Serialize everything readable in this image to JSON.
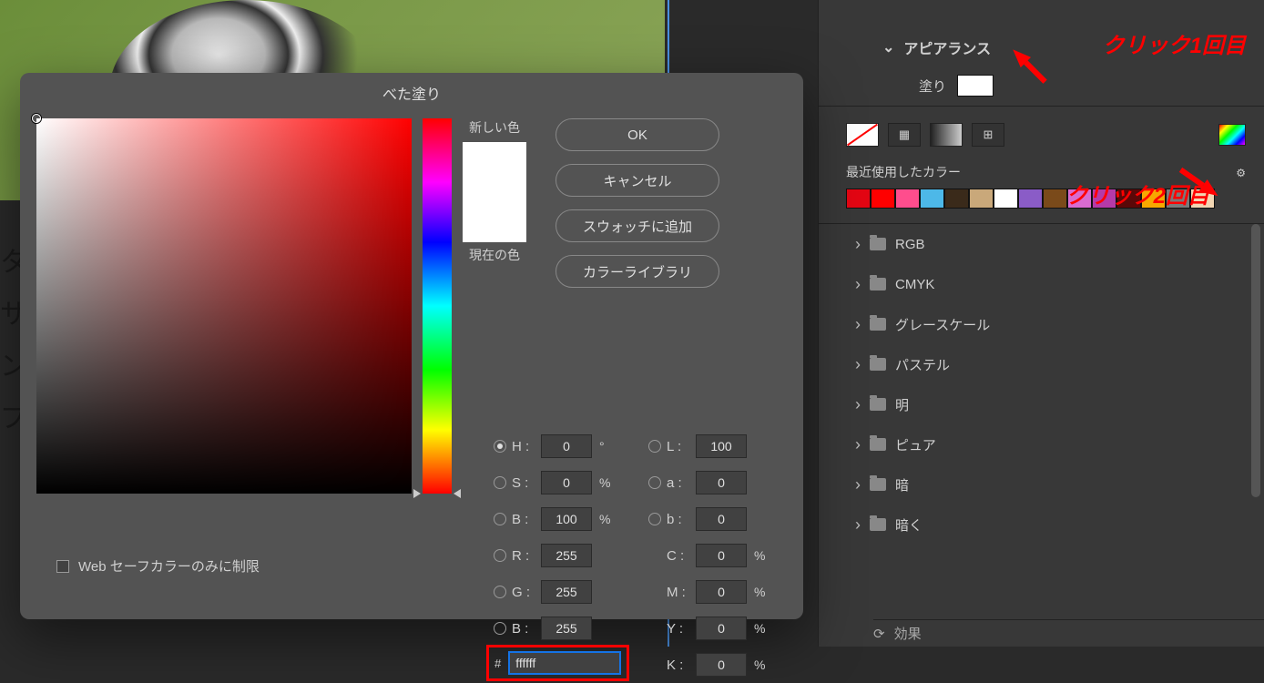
{
  "dialog": {
    "title": "べた塗り",
    "new_color_label": "新しい色",
    "current_color_label": "現在の色",
    "buttons": {
      "ok": "OK",
      "cancel": "キャンセル",
      "add_swatch": "スウォッチに追加",
      "color_library": "カラーライブラリ"
    },
    "hsb": {
      "h_label": "H :",
      "h": "0",
      "h_unit": "°",
      "s_label": "S :",
      "s": "0",
      "s_unit": "%",
      "b_label": "B :",
      "b": "100",
      "b_unit": "%"
    },
    "lab": {
      "l_label": "L :",
      "l": "100",
      "a_label": "a :",
      "a": "0",
      "b_label": "b :",
      "b": "0"
    },
    "rgb": {
      "r_label": "R :",
      "r": "255",
      "g_label": "G :",
      "g": "255",
      "b_label": "B :",
      "b": "255"
    },
    "cmyk": {
      "c_label": "C :",
      "c": "0",
      "m_label": "M :",
      "m": "0",
      "y_label": "Y :",
      "y": "0",
      "k_label": "K :",
      "k": "0",
      "unit": "%"
    },
    "hex_label": "#",
    "hex_value": "ffffff",
    "websafe_label": "Web セーフカラーのみに制限"
  },
  "panel": {
    "appearance_title": "アピアランス",
    "fill_label": "塗り",
    "recent_label": "最近使用したカラー",
    "swatches": [
      "#e30613",
      "#ff0000",
      "#ff4d8d",
      "#4db8e8",
      "#3a2a1a",
      "#c9a87a",
      "#ffffff",
      "#8a5cc7",
      "#7a4a1a",
      "#d96bd0",
      "#b53aa8",
      "#5a0808",
      "#f7a800",
      "#7a7a7a",
      "#f2d6b3"
    ],
    "folders": [
      "RGB",
      "CMYK",
      "グレースケール",
      "パステル",
      "明",
      "ピュア",
      "暗",
      "暗く"
    ],
    "effects_label": "効果"
  },
  "annotations": {
    "click1": "クリック1回目",
    "click2": "クリック2回目"
  },
  "left_text": {
    "t1": "タ",
    "t2": "サ",
    "t3": "ン",
    "t4": "プ"
  }
}
